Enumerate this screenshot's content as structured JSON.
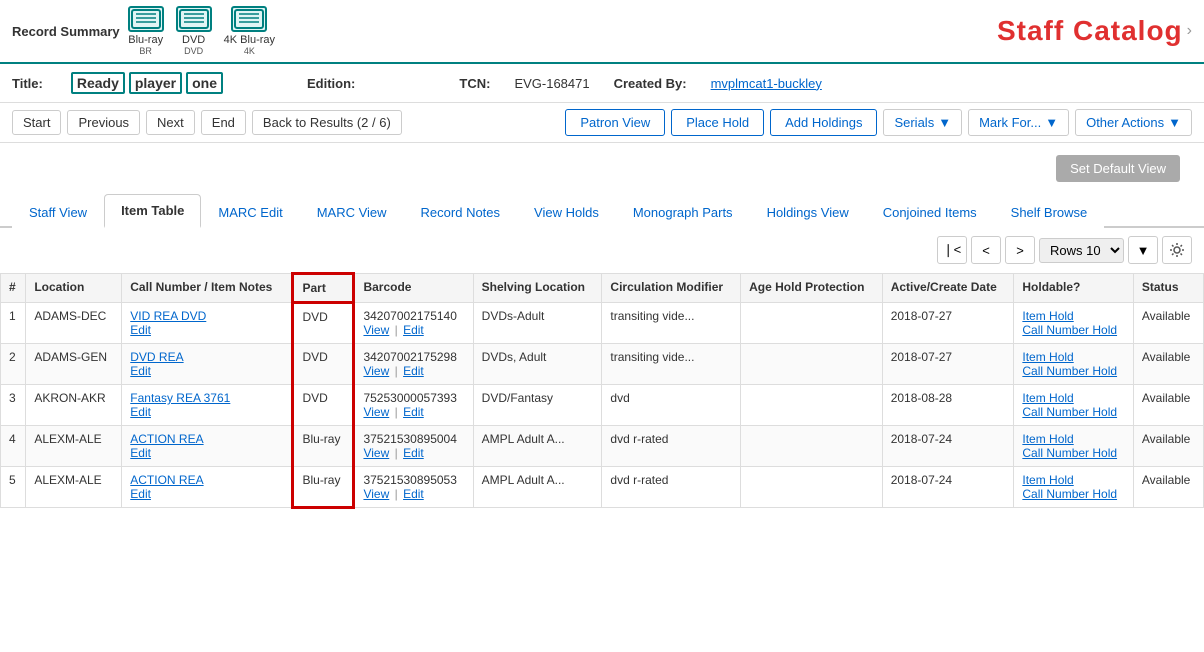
{
  "appTitle": "Staff Catalog",
  "recordSummary": {
    "label": "Record Summary",
    "badges": [
      {
        "icon": "BR",
        "label": "Blu-ray"
      },
      {
        "icon": "DVD",
        "label": "DVD"
      },
      {
        "icon": "4K",
        "label": "4K Blu-ray"
      }
    ]
  },
  "titleRow": {
    "titleLabel": "Title:",
    "titleWords": [
      "Ready",
      "player",
      "one"
    ],
    "edition": {
      "label": "Edition:",
      "value": ""
    },
    "tcn": {
      "label": "TCN:",
      "value": "EVG-168471"
    },
    "createdBy": {
      "label": "Created By:",
      "value": "mvplmcat1-buckley"
    }
  },
  "actionBar": {
    "navButtons": [
      "Start",
      "Previous",
      "Next",
      "End"
    ],
    "backToResults": "Back to Results (2 / 6)",
    "primaryButtons": [
      "Patron View",
      "Place Hold",
      "Add Holdings"
    ],
    "dropdownButtons": [
      "Serials",
      "Mark For...",
      "Other Actions"
    ]
  },
  "defaultViewBtn": "Set Default View",
  "tabs": {
    "items": [
      "Staff View",
      "Item Table",
      "MARC Edit",
      "MARC View",
      "Record Notes",
      "View Holds",
      "Monograph Parts",
      "Holdings View",
      "Conjoined Items",
      "Shelf Browse"
    ],
    "active": "Item Table"
  },
  "pagination": {
    "rowsLabel": "Rows 10"
  },
  "table": {
    "headers": [
      "#",
      "Location",
      "Call Number / Item Notes",
      "Part",
      "Barcode",
      "Shelving Location",
      "Circulation Modifier",
      "Age Hold Protection",
      "Active/Create Date",
      "Holdable?",
      "Status"
    ],
    "rows": [
      {
        "num": "1",
        "location": "ADAMS-DEC",
        "callNumber": "VID REA DVD",
        "part": "DVD",
        "barcode": "34207002175140",
        "shelvingLocation": "DVDs-Adult",
        "circulationModifier": "transiting vide...",
        "ageHoldProtection": "",
        "activeCreateDate": "2018-07-27",
        "holdable1": "Item Hold",
        "holdable2": "Call Number Hold",
        "status": "Available"
      },
      {
        "num": "2",
        "location": "ADAMS-GEN",
        "callNumber": "DVD REA",
        "part": "DVD",
        "barcode": "34207002175298",
        "shelvingLocation": "DVDs, Adult",
        "circulationModifier": "transiting vide...",
        "ageHoldProtection": "",
        "activeCreateDate": "2018-07-27",
        "holdable1": "Item Hold",
        "holdable2": "Call Number Hold",
        "status": "Available"
      },
      {
        "num": "3",
        "location": "AKRON-AKR",
        "callNumber": "Fantasy REA 3761",
        "part": "DVD",
        "barcode": "75253000057393",
        "shelvingLocation": "DVD/Fantasy",
        "circulationModifier": "dvd",
        "ageHoldProtection": "",
        "activeCreateDate": "2018-08-28",
        "holdable1": "Item Hold",
        "holdable2": "Call Number Hold",
        "status": "Available"
      },
      {
        "num": "4",
        "location": "ALEXM-ALE",
        "callNumber": "ACTION REA",
        "part": "Blu-ray",
        "barcode": "37521530895004",
        "shelvingLocation": "AMPL Adult A...",
        "circulationModifier": "dvd r-rated",
        "ageHoldProtection": "",
        "activeCreateDate": "2018-07-24",
        "holdable1": "Item Hold",
        "holdable2": "Call Number Hold",
        "status": "Available"
      },
      {
        "num": "5",
        "location": "ALEXM-ALE",
        "callNumber": "ACTION REA",
        "part": "Blu-ray",
        "barcode": "37521530895053",
        "shelvingLocation": "AMPL Adult A...",
        "circulationModifier": "dvd r-rated",
        "ageHoldProtection": "",
        "activeCreateDate": "2018-07-24",
        "holdable1": "Item Hold",
        "holdable2": "Call Number Hold",
        "status": "Available"
      }
    ]
  }
}
